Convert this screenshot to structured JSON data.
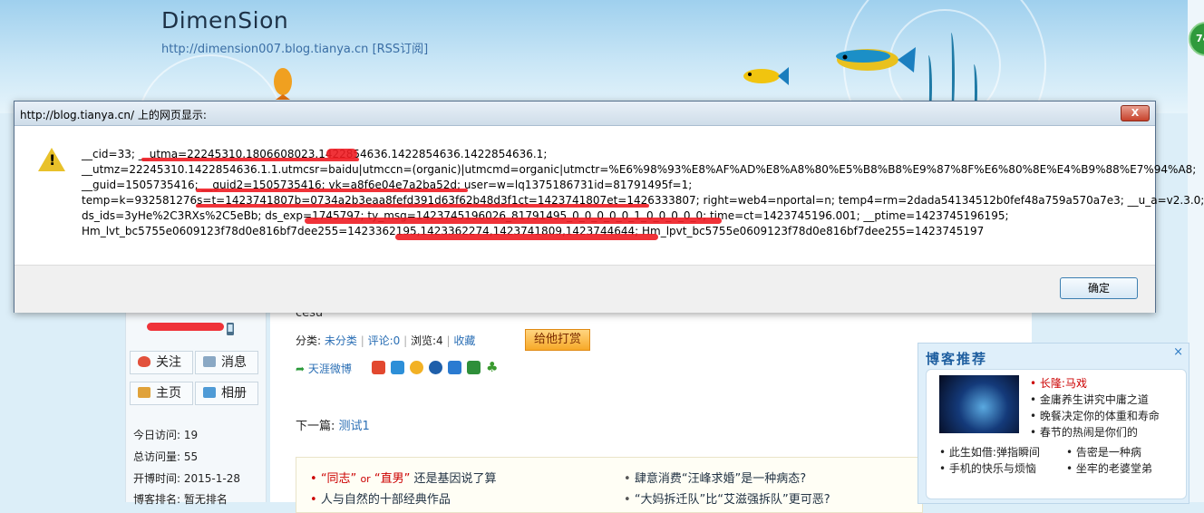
{
  "blog": {
    "title": "DimenSion",
    "url": "http://dimension007.blog.tianya.cn",
    "rss": "[RSS订阅]"
  },
  "bubble_number": "74",
  "sidebar": {
    "follow": "关注",
    "message": "消息",
    "home": "主页",
    "album": "相册",
    "stats": [
      {
        "label": "今日访问:",
        "value": "19"
      },
      {
        "label": "总访问量:",
        "value": "55"
      },
      {
        "label": "开博时间:",
        "value": "2015-1-28"
      },
      {
        "label": "博客排名:",
        "value": "暂无排名"
      }
    ]
  },
  "post": {
    "body_text": "cesu",
    "category_label": "分类:",
    "category_value": "未分类",
    "comments": "评论:0",
    "views": "浏览:4",
    "favorite": "收藏",
    "tip_button": "给他打赏",
    "share_label": "天涯微博",
    "next_label": "下一篇:",
    "next_title": "测试1"
  },
  "related": [
    {
      "q1": "“同志”",
      "or": "or",
      "q2": "“直男”",
      "rest": "还是基因说了算"
    },
    {
      "text": "人与自然的十部经典作品"
    },
    {
      "text": "肆意消费“汪峰求婚”是一种病态?"
    },
    {
      "text": "“大妈拆迁队”比“艾滋强拆队”更可恶?"
    }
  ],
  "recommend": {
    "title": "博客推荐",
    "close": "×",
    "items": [
      {
        "text": "长隆:马戏",
        "highlight": true
      },
      {
        "text": "金庸养生讲究中庸之道"
      },
      {
        "text": "晚餐决定你的体重和寿命"
      },
      {
        "text": "春节的热闹是你们的"
      }
    ],
    "bottom": [
      "此生如借:弹指瞬间",
      "告密是一种病",
      "手机的快乐与烦恼",
      "坐牢的老婆堂弟"
    ]
  },
  "dialog": {
    "title": "http://blog.tianya.cn/ 上的网页显示:",
    "close": "X",
    "lines": [
      "__cid=33; __utma=22245310.1806608023.1422854636.1422854636.1422854636.1;",
      "__utmz=22245310.1422854636.1.1.utmcsr=baidu|utmccn=(organic)|utmcmd=organic|utmctr=%E6%98%93%E8%AF%AD%E8%A8%80%E5%B8%B8%E9%87%8F%E6%80%8E%E4%B9%88%E7%94%A8;",
      "__guid=1505735416; __guid2=1505735416; vk=a8f6e04e7a2ba52d; user=w=lq1375186731id=81791495f=1;",
      "temp=k=932581276s=t=1423741807b=0734a2b3eaa8fefd391d63f62b48d3f1ct=1423741807et=1426333807; right=web4=nportal=n; temp4=rm=2dada54134512b0fef48a759a570a7e3; __u_a=v2.3.0;",
      "ds_ids=3yHe%2C3RXs%2C5eBb; ds_exp=1745797; ty_msg=1423745196026_81791495_0_0_0_0_0_1_0_0_0_0_0; time=ct=1423745196.001; __ptime=1423745196195;",
      "Hm_lvt_bc5755e0609123f78d0e816bf7dee255=1423362195,1423362274,1423741809,1423744644; Hm_lpvt_bc5755e0609123f78d0e816bf7dee255=1423745197"
    ],
    "ok": "确定"
  }
}
